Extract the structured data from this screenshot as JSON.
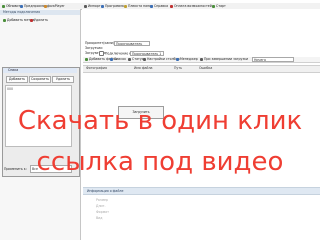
{
  "toolbar": {
    "items": [
      {
        "label": "Обновить",
        "icon_color": "#4a8e3a"
      },
      {
        "label": "Предпросмотр",
        "icon_color": "#3b6fb6"
      },
      {
        "label": "JavaPlayer",
        "icon_color": "#d08a2a"
      },
      {
        "label": "Импорт",
        "icon_color": "#5a5a5a"
      },
      {
        "label": "Программа",
        "icon_color": "#3b6fb6"
      },
      {
        "label": "Плеиста папка",
        "icon_color": "#c0a030"
      },
      {
        "label": "Справка",
        "icon_color": "#3b6fb6"
      },
      {
        "label": "Оплата возможностей",
        "icon_color": "#c03030"
      },
      {
        "label": "Старт",
        "icon_color": "#4a8e3a"
      }
    ]
  },
  "left_panel": {
    "header": "Методы подключения",
    "buttons": [
      "Добавить метод",
      "Удалить"
    ]
  },
  "dialog": {
    "title": "Спика",
    "buttons": [
      "Добавить",
      "Сохранить",
      "Удалить"
    ],
    "list_item": "000",
    "field_label": "Применить к:",
    "field_value": "Все"
  },
  "right_panel": {
    "row1_label": "Приоритет(ками):",
    "row1_value": "Проигрыватель",
    "row2_label": "Загрузчик:",
    "row3_label": "Загрузить в:",
    "check_label": "Подключение к файлу",
    "row3_value": "Проигрыватель 1",
    "toolbar2": {
      "items": [
        "Добавить файлы",
        "Список",
        "Статус",
        "Настройки столбца",
        "Менеджер",
        "При завершении загрузки"
      ],
      "combo_value": "Ничего"
    },
    "columns": [
      "Фотография",
      "Имя файла",
      "Путь",
      "Ошибка"
    ],
    "center_button": "Загрузить",
    "info_header": "Информация о файле",
    "info_rows": [
      "Размер",
      "Длит.",
      "Формат",
      "Вид"
    ]
  },
  "overlay": {
    "line1": "Скачать в один клик",
    "line2": "ссылка под видео",
    "color": "#ef3e33"
  }
}
